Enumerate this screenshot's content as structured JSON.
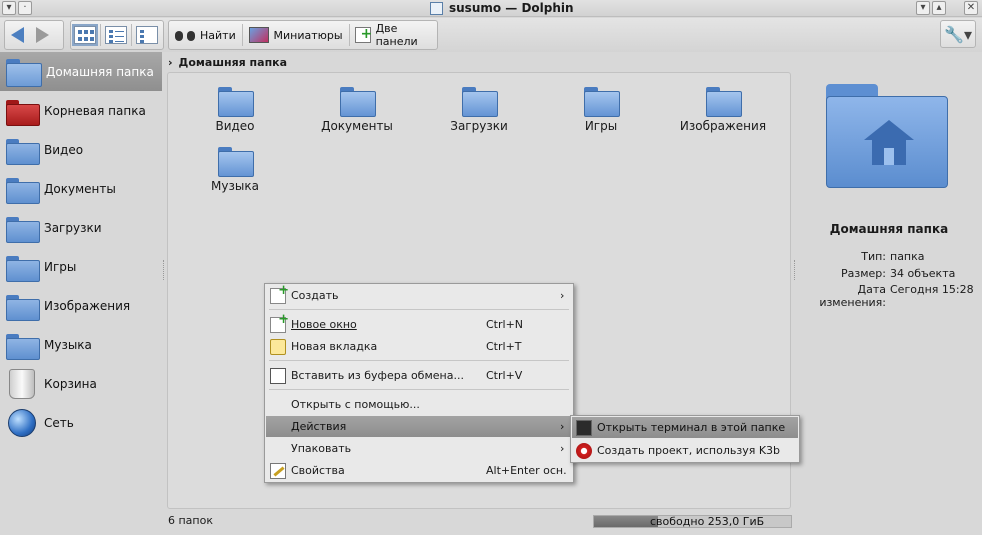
{
  "window": {
    "title": "susumo — Dolphin"
  },
  "toolbar": {
    "find_label": "Найти",
    "thumbnails_label": "Миниатюры",
    "split_label": "Две панели"
  },
  "sidebar": {
    "items": [
      {
        "label": "Домашняя папка",
        "icon": "home-folder-icon"
      },
      {
        "label": "Корневая папка",
        "icon": "root-folder-icon"
      },
      {
        "label": "Видео",
        "icon": "folder-icon"
      },
      {
        "label": "Документы",
        "icon": "folder-icon"
      },
      {
        "label": "Загрузки",
        "icon": "folder-icon"
      },
      {
        "label": "Игры",
        "icon": "folder-icon"
      },
      {
        "label": "Изображения",
        "icon": "folder-icon"
      },
      {
        "label": "Музыка",
        "icon": "folder-icon"
      },
      {
        "label": "Корзина",
        "icon": "trash-icon"
      },
      {
        "label": "Сеть",
        "icon": "network-globe-icon"
      }
    ]
  },
  "breadcrumb": {
    "current": "Домашняя папка"
  },
  "files": [
    {
      "name": "Видео"
    },
    {
      "name": "Документы"
    },
    {
      "name": "Загрузки"
    },
    {
      "name": "Игры"
    },
    {
      "name": "Изображения"
    },
    {
      "name": "Музыка"
    }
  ],
  "status": {
    "folders": "6 папок",
    "free_space": "свободно 253,0 ГиБ"
  },
  "info": {
    "title": "Домашняя папка",
    "type_key": "Тип:",
    "type_val": "папка",
    "size_key": "Размер:",
    "size_val": "34 объекта",
    "date_key": "Дата изменения:",
    "date_val": "Сегодня 15:28"
  },
  "context_menu": {
    "create": "Создать",
    "new_window": "Новое окно",
    "new_window_sc": "Ctrl+N",
    "new_tab": "Новая вкладка",
    "new_tab_sc": "Ctrl+T",
    "paste": "Вставить из буфера обмена...",
    "paste_sc": "Ctrl+V",
    "open_with": "Открыть с помощью...",
    "actions": "Действия",
    "pack": "Упаковать",
    "properties": "Свойства",
    "properties_sc": "Alt+Enter осн."
  },
  "submenu": {
    "terminal": "Открыть терминал в этой папке",
    "k3b": "Создать проект, используя K3b"
  }
}
